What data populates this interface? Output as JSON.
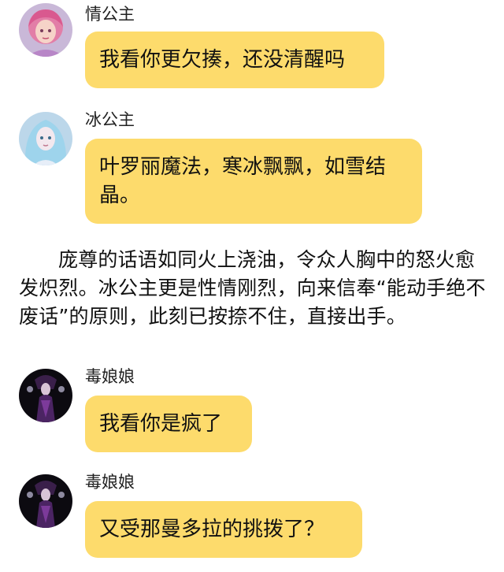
{
  "messages": [
    {
      "sender": "情公主",
      "text": "我看你更欠揍，还没清醒吗",
      "avatar_icon": "princess-pink-avatar-icon"
    },
    {
      "sender": "冰公主",
      "text": "叶罗丽魔法，寒冰飘飘，如雪结晶。",
      "avatar_icon": "princess-ice-avatar-icon"
    },
    {
      "sender": "毒娘娘",
      "text": "我看你是疯了",
      "avatar_icon": "poison-queen-avatar-icon"
    },
    {
      "sender": "毒娘娘",
      "text": "又受那曼多拉的挑拨了？",
      "avatar_icon": "poison-queen-avatar-icon"
    }
  ],
  "narration": "庞尊的话语如同火上浇油，令众人胸中的怒火愈发炽烈。冰公主更是性情刚烈，向来信奉“能动手绝不废话”的原则，此刻已按捺不住，直接出手。",
  "colors": {
    "bubble": "#fddb6c",
    "background": "#ffffff"
  }
}
